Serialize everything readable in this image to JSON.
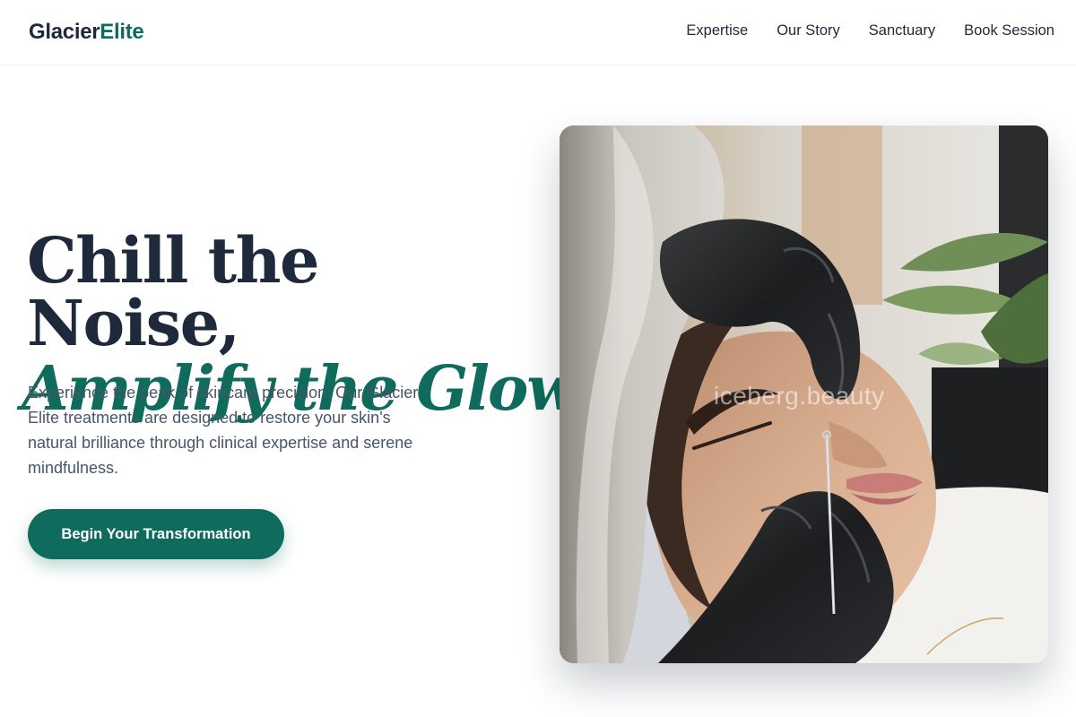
{
  "brand": {
    "name_part1": "Glacier",
    "name_part2": "Elite",
    "accent_color": "#0f6b5b",
    "text_color": "#1e293b"
  },
  "nav": {
    "items": [
      {
        "label": "Expertise"
      },
      {
        "label": "Our Story"
      },
      {
        "label": "Sanctuary"
      },
      {
        "label": "Book Session"
      }
    ]
  },
  "hero": {
    "headline_line1": "Chill the Noise,",
    "headline_line2": "Amplify the Glow.",
    "description": "Experience the peak of skincare precision. Our Glacier Elite treatments are designed to restore your skin's natural brilliance through clinical expertise and serene mindfulness.",
    "cta_label": "Begin Your Transformation",
    "image_watermark": "iceberg.beauty",
    "image_alt": "Esthetician in black gloves performing a facial extraction treatment"
  }
}
